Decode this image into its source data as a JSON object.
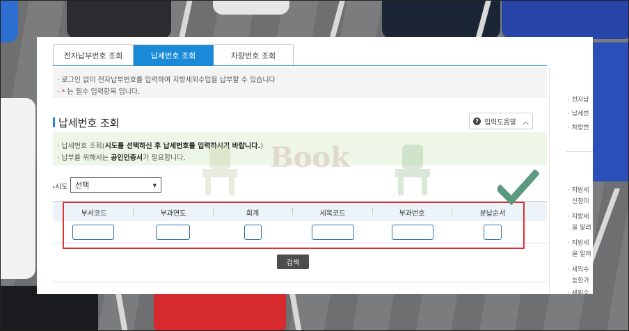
{
  "tabs": [
    {
      "label": "전자납부번호 조회",
      "active": false
    },
    {
      "label": "납세번호 조회",
      "active": true
    },
    {
      "label": "차량번호 조회",
      "active": false
    }
  ],
  "notice": {
    "line1": "· 로그인 없이 전자납부번호를 입력하여 지방세외수입을 납부할 수 있습니다",
    "line2_prefix": "· ",
    "line2_star": "*",
    "line2_suffix": "는 필수 입력항목 입니다."
  },
  "section": {
    "title": "납세번호 조회",
    "help_button": "입력도움말"
  },
  "guide": {
    "line1_prefix": "· 납세번호 조회(",
    "line1_bold": "시도를 선택하신 후 납세번호를 입력하시기 바랍니다.",
    "line1_suffix": ")",
    "line2_prefix": "· 납부를 위해서는 ",
    "line2_bold": "공인인증서",
    "line2_suffix": "가 필요합니다."
  },
  "watermark": "Book",
  "sido": {
    "label": "›시도",
    "selected": "선택"
  },
  "columns": [
    "부서코드",
    "부과연도",
    "회계",
    "세목코드",
    "부과번호",
    "분납순서"
  ],
  "search_button": "검색",
  "right_sidebar": {
    "links": [
      "· 전자납",
      "· 납세번",
      "· 차량번"
    ],
    "notes": [
      "· 지방세",
      "신청이",
      "· 지방세",
      "을 알려",
      "· 지방세",
      "을 알려",
      "· 세외수",
      "능한가",
      "· 세외수"
    ]
  },
  "colors": {
    "accent": "#1a8ad8",
    "highlight_box": "#e03030",
    "checkmark": "#5c9a80",
    "guide_bg": "#eef7e7"
  }
}
